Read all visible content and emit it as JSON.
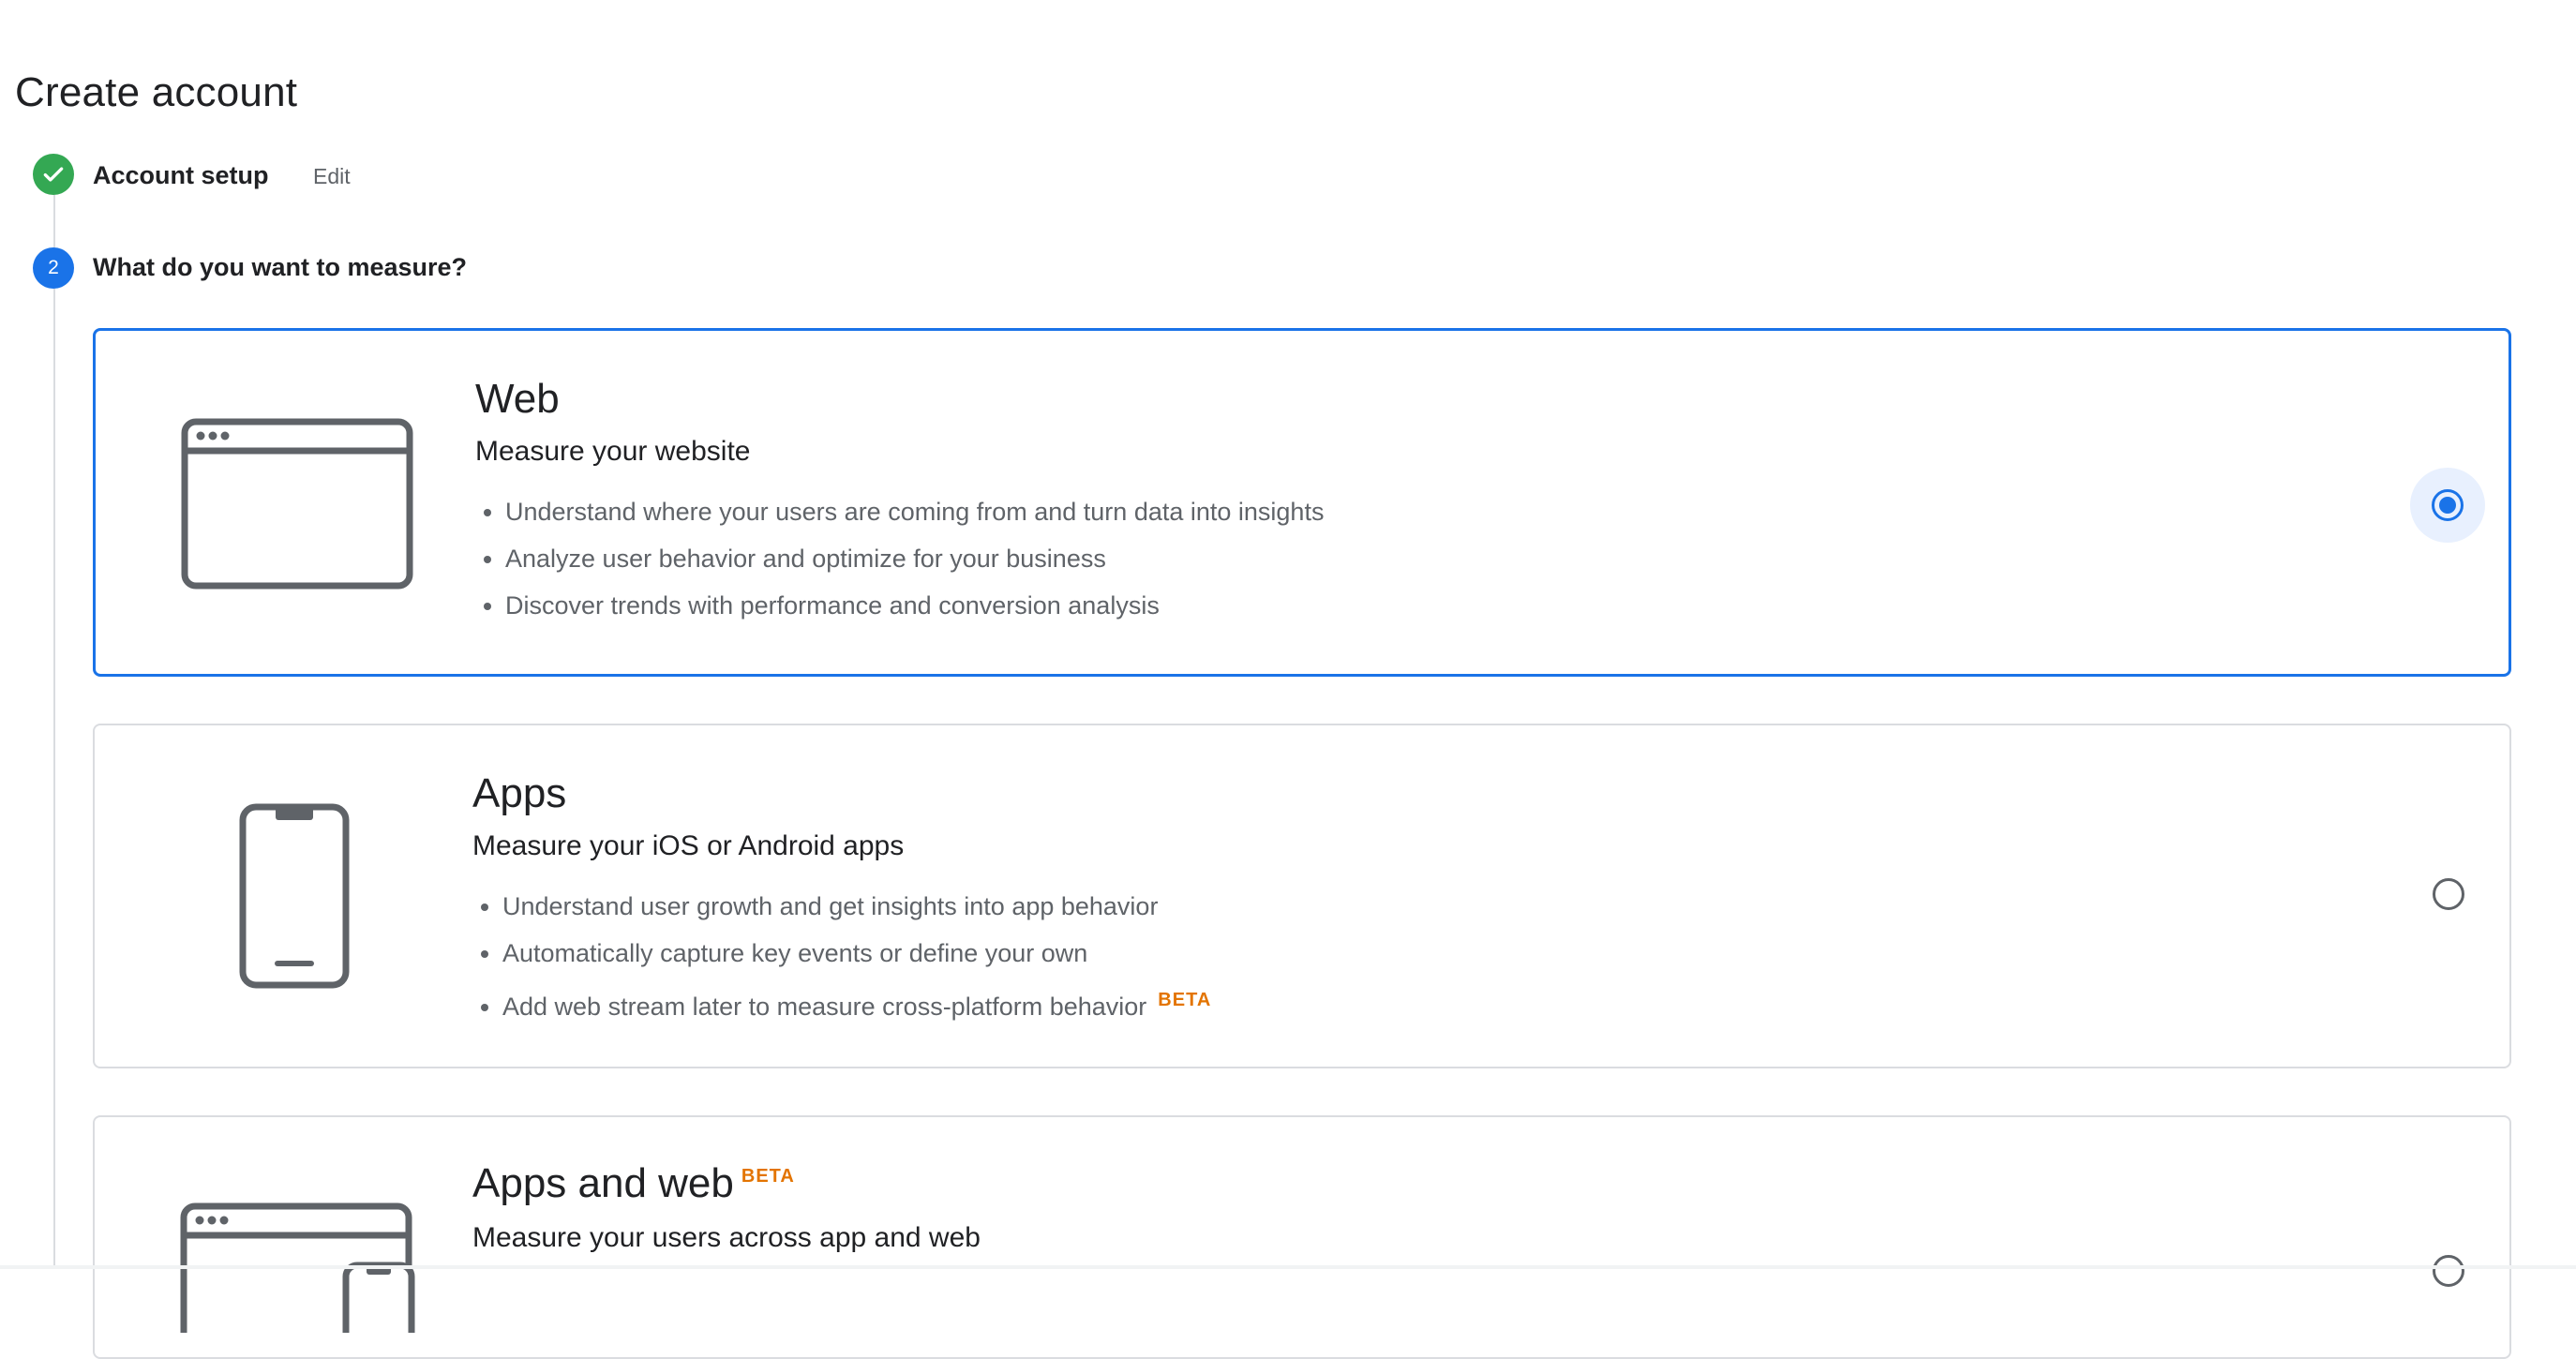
{
  "page": {
    "title": "Create account"
  },
  "steps": [
    {
      "label": "Account setup",
      "edit_label": "Edit",
      "status": "done",
      "icon": "check-icon"
    },
    {
      "number": "2",
      "label": "What do you want to measure?",
      "status": "active"
    }
  ],
  "options": [
    {
      "id": "web",
      "title": "Web",
      "subtitle": "Measure your website",
      "bullets": [
        "Understand where your users are coming from and turn data into insights",
        "Analyze user behavior and optimize for your business",
        "Discover trends with performance and conversion analysis"
      ],
      "selected": true,
      "icon": "browser-window-icon"
    },
    {
      "id": "apps",
      "title": "Apps",
      "subtitle": "Measure your iOS or Android apps",
      "bullets": [
        "Understand user growth and get insights into app behavior",
        "Automatically capture key events or define your own",
        "Add web stream later to measure cross-platform behavior"
      ],
      "bullet_badge": "BETA",
      "selected": false,
      "icon": "phone-icon"
    },
    {
      "id": "apps-and-web",
      "title": "Apps and web",
      "title_badge": "BETA",
      "subtitle": "Measure your users across app and web",
      "selected": false,
      "icon": "browser-and-phone-icon"
    }
  ],
  "colors": {
    "accent": "#1a73e8",
    "success": "#34a853",
    "beta": "#e37400",
    "border": "#dadce0",
    "secondary_text": "#5f6368"
  }
}
